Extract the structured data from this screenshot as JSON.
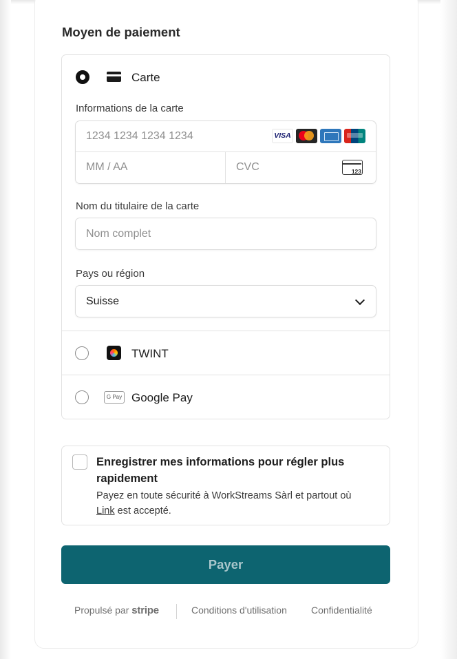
{
  "payment": {
    "section_title": "Moyen de paiement",
    "methods": [
      {
        "label": "Carte",
        "icon": "credit-card-icon",
        "selected": true
      },
      {
        "label": "TWINT",
        "icon": "twint-icon",
        "selected": false
      },
      {
        "label": "Google Pay",
        "icon": "google-pay-icon",
        "icon_text": "G Pay",
        "selected": false
      }
    ],
    "card_info_label": "Informations de la carte",
    "card_number_placeholder": "1234 1234 1234 1234",
    "card_brands": [
      {
        "name": "visa-icon",
        "text": "VISA"
      },
      {
        "name": "mastercard-icon"
      },
      {
        "name": "amex-icon"
      },
      {
        "name": "unionpay-icon"
      }
    ],
    "expiry_placeholder": "MM / AA",
    "cvc_placeholder": "CVC",
    "cvc_icon_text": "123",
    "cardholder_label": "Nom du titulaire de la carte",
    "cardholder_placeholder": "Nom complet",
    "country_label": "Pays ou région",
    "country_value": "Suisse"
  },
  "save_info": {
    "checked": false,
    "title": "Enregistrer mes informations pour régler plus rapidement",
    "desc_prefix": "Payez en toute sécurité à WorkStreams Sàrl et partout où ",
    "desc_link": "Link",
    "desc_suffix": " est accepté."
  },
  "pay_button_label": "Payer",
  "footer": {
    "powered_by": "Propulsé par",
    "stripe": "stripe",
    "terms": "Conditions d'utilisation",
    "privacy": "Confidentialité"
  },
  "colors": {
    "pay_button_bg": "#0d6470",
    "pay_button_text": "#a9c6cb"
  }
}
